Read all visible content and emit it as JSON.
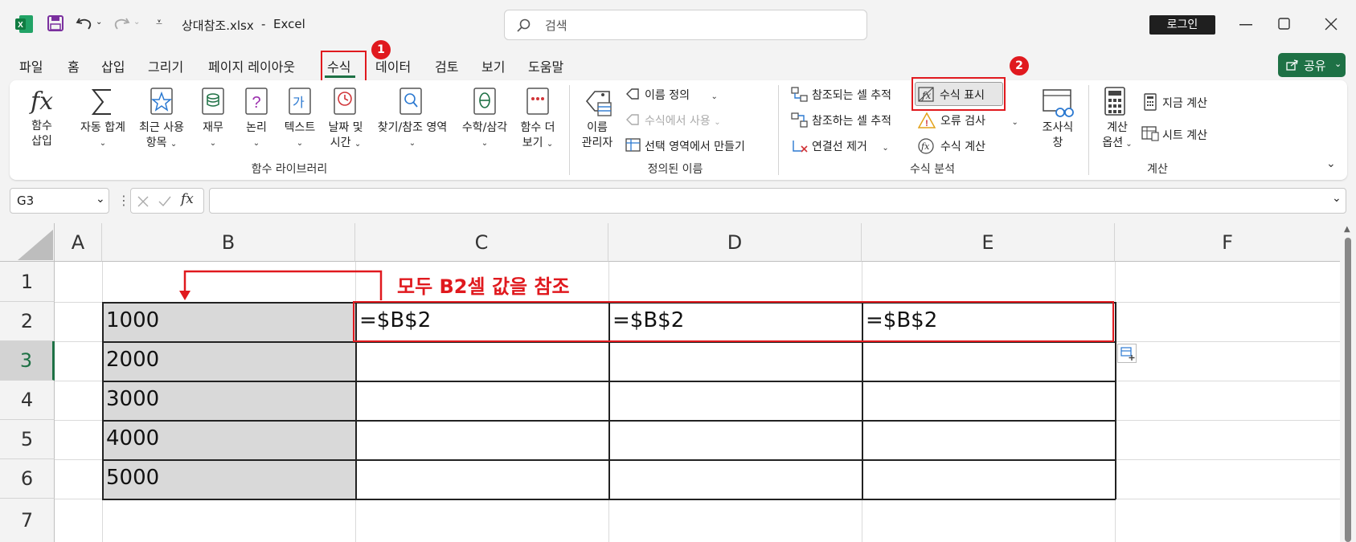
{
  "titlebar": {
    "filename": "상대참조.xlsx",
    "separator": "-",
    "app": "Excel",
    "search_placeholder": "검색",
    "login": "로그인"
  },
  "tabs": [
    "파일",
    "홈",
    "삽입",
    "그리기",
    "페이지 레이아웃",
    "수식",
    "데이터",
    "검토",
    "보기",
    "도움말"
  ],
  "active_tab": "수식",
  "share": "공유",
  "badges": {
    "one": "1",
    "two": "2"
  },
  "ribbon": {
    "insert_function": [
      "함수",
      "삽입"
    ],
    "autosum": "자동 합계",
    "recent": [
      "최근 사용",
      "항목"
    ],
    "finance": "재무",
    "logic": "논리",
    "text": "텍스트",
    "datetime": [
      "날짜 및",
      "시간"
    ],
    "lookup": "찾기/참조 영역",
    "math": "수학/삼각",
    "more": [
      "함수 더",
      "보기"
    ],
    "group_library": "함수 라이브러리",
    "name_manager": [
      "이름",
      "관리자"
    ],
    "define_name": "이름 정의",
    "use_in_formula": "수식에서 사용",
    "create_from_selection": "선택 영역에서 만들기",
    "group_defined_names": "정의된 이름",
    "trace_precedents": "참조되는 셀 추적",
    "trace_dependents": "참조하는 셀 추적",
    "remove_arrows": "연결선 제거",
    "show_formulas": "수식 표시",
    "error_checking": "오류 검사",
    "evaluate_formula": "수식 계산",
    "watch_window": [
      "조사식",
      "창"
    ],
    "group_formula_auditing": "수식 분석",
    "calc_options": [
      "계산",
      "옵션"
    ],
    "calc_now": "지금 계산",
    "calc_sheet": "시트 계산",
    "group_calculation": "계산",
    "glyph_gaga": "가"
  },
  "formula_bar": {
    "namebox": "G3",
    "fx": "fx",
    "value": ""
  },
  "columns": [
    "A",
    "B",
    "C",
    "D",
    "E",
    "F"
  ],
  "rows": [
    "1",
    "2",
    "3",
    "4",
    "5",
    "6",
    "7"
  ],
  "cells": {
    "B2": "1000",
    "B3": "2000",
    "B4": "3000",
    "B5": "4000",
    "B6": "5000",
    "C2": "=$B$2",
    "D2": "=$B$2",
    "E2": "=$B$2"
  },
  "annotation": "모두 B2셀 값을 참조",
  "colors": {
    "excel_green": "#1e7145",
    "annotation_red": "#e0191e",
    "selected_fill": "#d9d9d9"
  }
}
